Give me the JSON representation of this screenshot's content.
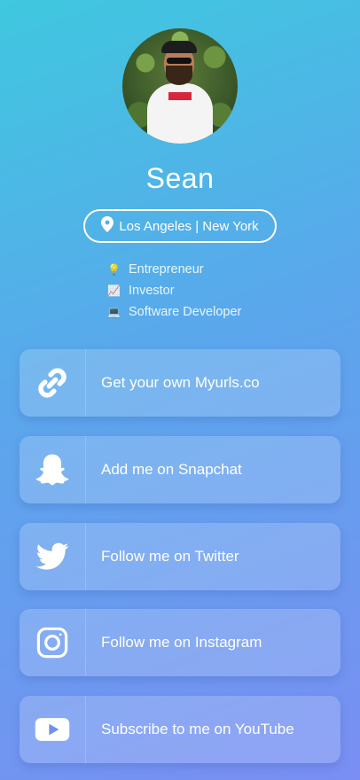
{
  "profile": {
    "name": "Sean",
    "location": "Los Angeles | New York",
    "roles": [
      {
        "emoji": "💡",
        "label": "Entrepreneur"
      },
      {
        "emoji": "📈",
        "label": "Investor"
      },
      {
        "emoji": "💻",
        "label": "Software Developer"
      }
    ]
  },
  "links": [
    {
      "icon": "link-icon",
      "label": "Get your own Myurls.co"
    },
    {
      "icon": "snapchat-icon",
      "label": "Add me on Snapchat"
    },
    {
      "icon": "twitter-icon",
      "label": "Follow me on Twitter"
    },
    {
      "icon": "instagram-icon",
      "label": "Follow me on Instagram"
    },
    {
      "icon": "youtube-icon",
      "label": "Subscribe to me on YouTube"
    }
  ]
}
